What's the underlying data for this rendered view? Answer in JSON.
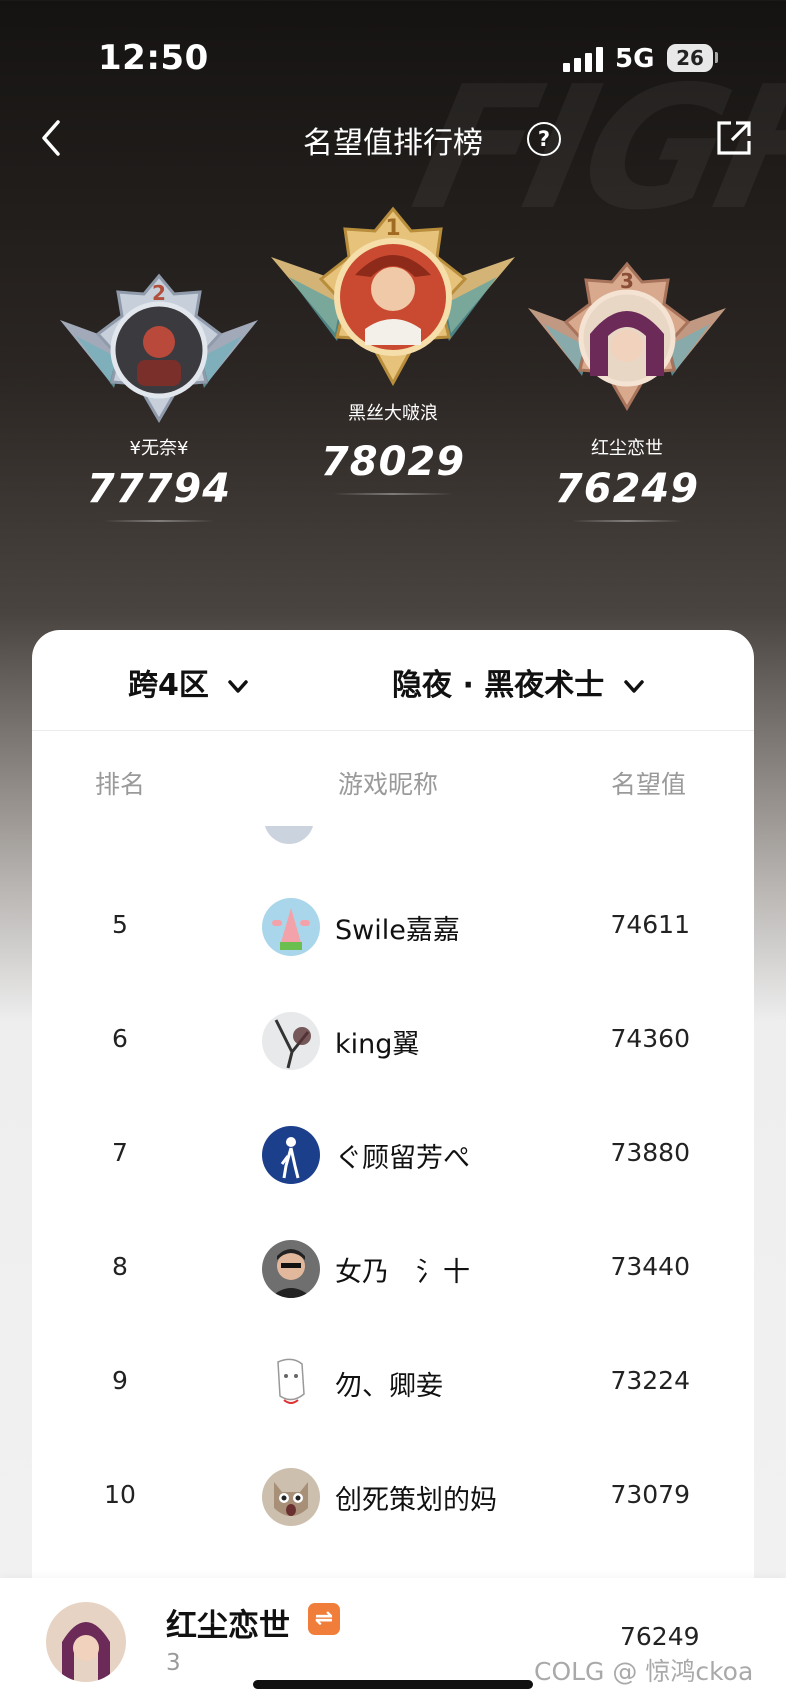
{
  "status_bar": {
    "time": "12:50",
    "network": "5G",
    "battery": "26"
  },
  "header": {
    "title": "名望值排行榜",
    "help": "?"
  },
  "podium": [
    {
      "place": "2",
      "name": "¥无奈¥",
      "score": "77794",
      "color": "#a9b3c4"
    },
    {
      "place": "1",
      "name": "黑丝大啵浪",
      "score": "78029",
      "color": "#d9b46a"
    },
    {
      "place": "3",
      "name": "红尘恋世",
      "score": "76249",
      "color": "#c99779"
    }
  ],
  "filters": {
    "server": "跨4区",
    "job": "隐夜 · 黑夜术士"
  },
  "table": {
    "headers": {
      "rank": "排名",
      "nickname": "游戏昵称",
      "score": "名望值"
    },
    "rows": [
      {
        "rank": "5",
        "name": "Swile嘉嘉",
        "score": "74611",
        "avatar": "patrick-avatar"
      },
      {
        "rank": "6",
        "name": "king翼",
        "score": "74360",
        "avatar": "ink-avatar"
      },
      {
        "rank": "7",
        "name": "ぐ顾留芳ぺ",
        "score": "73880",
        "avatar": "silhouette-avatar"
      },
      {
        "rank": "8",
        "name": "女乃　氵十",
        "score": "73440",
        "avatar": "man-avatar"
      },
      {
        "rank": "9",
        "name": "勿、卿妾",
        "score": "73224",
        "avatar": "sketch-avatar"
      },
      {
        "rank": "10",
        "name": "创死策划的妈",
        "score": "73079",
        "avatar": "cat-avatar"
      }
    ]
  },
  "me": {
    "name": "红尘恋世",
    "badge": "⇌",
    "rank": "3",
    "score": "76249"
  },
  "watermark": "COLG @ 惊鸿ckoa",
  "colors": {
    "accent_badge": "#f07e3a",
    "card_bg": "#ffffff",
    "muted_text": "#9a9a9a"
  }
}
